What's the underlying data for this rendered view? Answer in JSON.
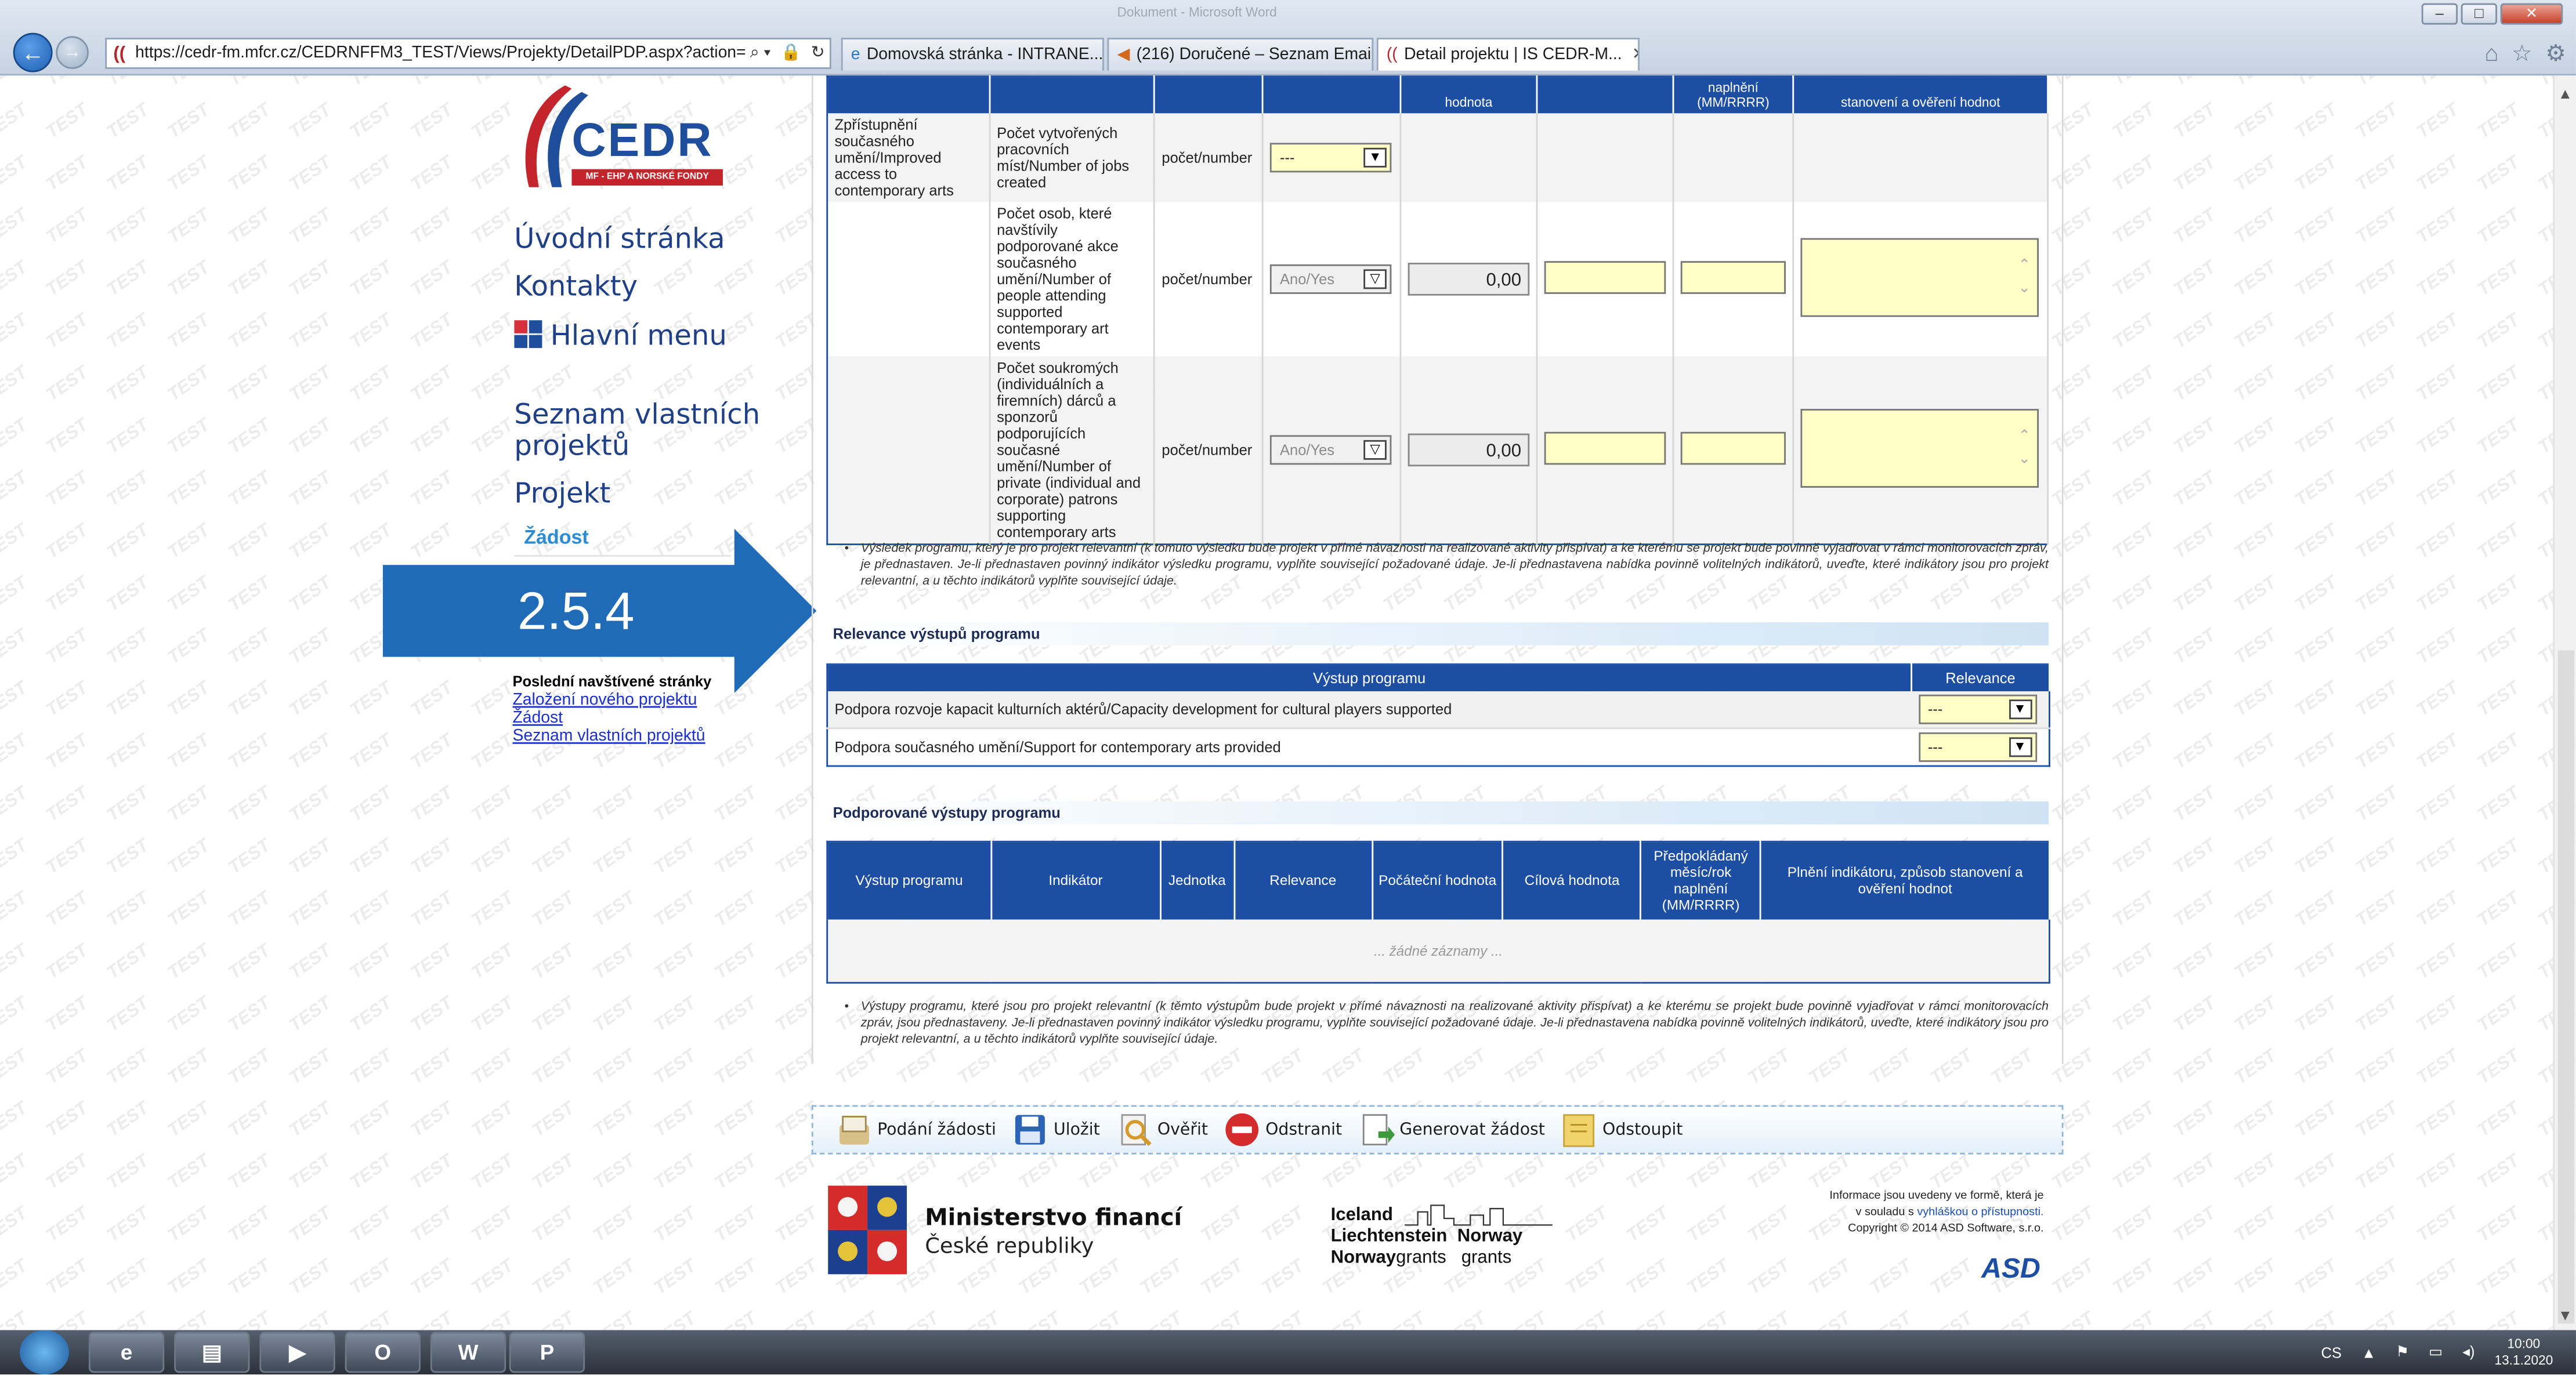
{
  "browser": {
    "window_title": "Dokument - Microsoft Word",
    "url": "https://cedr-fm.mfcr.cz/CEDRNFFM3_TEST/Views/Projekty/DetailPDP.aspx?action=g",
    "tabs": [
      {
        "label": "Domovská stránka - INTRANE..."
      },
      {
        "label": "(216) Doručené – Seznam Email"
      },
      {
        "label": "Detail projektu | IS CEDR-M..."
      }
    ]
  },
  "watermark_text": "TEST",
  "logo": {
    "text": "CEDR",
    "subtitle": "MF - EHP A NORSKÉ FONDY"
  },
  "nav": {
    "home": "Úvodní stránka",
    "contacts": "Kontakty",
    "main_menu": "Hlavní menu",
    "own_projects": "Seznam vlastních projektů",
    "project": "Projekt",
    "application": "Žádost"
  },
  "recent": {
    "title": "Poslední navštívené stránky",
    "links": [
      "Založení nového projektu",
      "Žádost",
      "Seznam vlastních projektů"
    ]
  },
  "callout": {
    "label": "2.5.4",
    "color": "#1f6bb8"
  },
  "table1": {
    "header": [
      "",
      "",
      "",
      "",
      "hodnota",
      "",
      "naplnění (MM/RRRR)",
      "stanovení a ověření hodnot"
    ],
    "rows": [
      {
        "result": "Zpřístupnění současného umění/Improved access to contemporary arts",
        "indicator": "Počet vytvořených pracovních míst/Number of jobs created",
        "unit": "počet/number",
        "relevance": "---"
      },
      {
        "result": "",
        "indicator": "Počet osob, které navštívily podporované akce současného umění/Number of people attending supported contemporary art events",
        "unit": "počet/number",
        "relevance": "Ano/Yes",
        "initial": "0,00"
      },
      {
        "result": "",
        "indicator": "Počet soukromých (individuálních a firemních) dárců a sponzorů podporujících současné umění/Number of private (individual and corporate) patrons supporting contemporary arts",
        "unit": "počet/number",
        "relevance": "Ano/Yes",
        "initial": "0,00"
      }
    ]
  },
  "note1": "Výsledek programu, který je pro projekt relevantní (k tomuto výsledku bude projekt v přímé návaznosti na realizované aktivity přispívat) a ke kterému se projekt bude povinně vyjadřovat v rámci monitorovacích zpráv, je přednastaven. Je-li přednastaven povinný indikátor výsledku programu, vyplňte související požadované údaje. Je-li přednastavena nabídka povinně volitelných indikátorů, uveďte, které indikátory jsou pro projekt relevantní, a u těchto indikátorů vyplňte související údaje.",
  "section_relevance": "Relevance výstupů programu",
  "table2": {
    "header": [
      "Výstup programu",
      "Relevance"
    ],
    "rows": [
      {
        "output": "Podpora rozvoje kapacit kulturních aktérů/Capacity development for cultural players supported",
        "relevance": "---"
      },
      {
        "output": "Podpora současného umění/Support for contemporary arts provided",
        "relevance": "---"
      }
    ]
  },
  "section_supported": "Podporované výstupy programu",
  "table3": {
    "header": [
      "Výstup programu",
      "Indikátor",
      "Jednotka",
      "Relevance",
      "Počáteční hodnota",
      "Cílová hodnota",
      "Předpokládaný měsíc/rok naplnění (MM/RRRR)",
      "Plnění indikátoru, způsob stanovení a ověření hodnot"
    ],
    "empty_text": "... žádné záznamy ..."
  },
  "note2": "Výstupy programu, které jsou pro projekt relevantní (k těmto výstupům bude projekt v přímé návaznosti na realizované aktivity přispívat) a ke kterému se projekt bude povinně vyjadřovat v rámci monitorovacích zpráv, jsou přednastaveny. Je-li přednastaven povinný indikátor výsledku programu, vyplňte související požadované údaje. Je-li přednastavena nabídka povinně volitelných indikátorů, uveďte, které indikátory jsou pro projekt relevantní, a u těchto indikátorů vyplňte související údaje.",
  "toolbar": {
    "submit": "Podání žádosti",
    "save": "Uložit",
    "verify": "Ověřit",
    "remove": "Odstranit",
    "generate": "Generovat žádost",
    "withdraw": "Odstoupit"
  },
  "footer": {
    "ministry_line1": "Ministerstvo financí",
    "ministry_line2": "České republiky",
    "grants": {
      "iceland": "Iceland",
      "liechtenstein": "Liechtenstein",
      "norway": "Norway",
      "norway_grants": "Norway",
      "grants1": "grants",
      "grants2": "grants"
    },
    "info_line1": "Informace jsou uvedeny ve formě, která je",
    "info_line2_prefix": "v souladu s ",
    "info_line2_link": "vyhláškou o přístupnosti.",
    "copyright": "Copyright © 2014 ASD Software, s.r.o.",
    "asd": "ASD"
  },
  "taskbar": {
    "lang": "CS",
    "time": "10:00",
    "date": "13.1.2020"
  }
}
